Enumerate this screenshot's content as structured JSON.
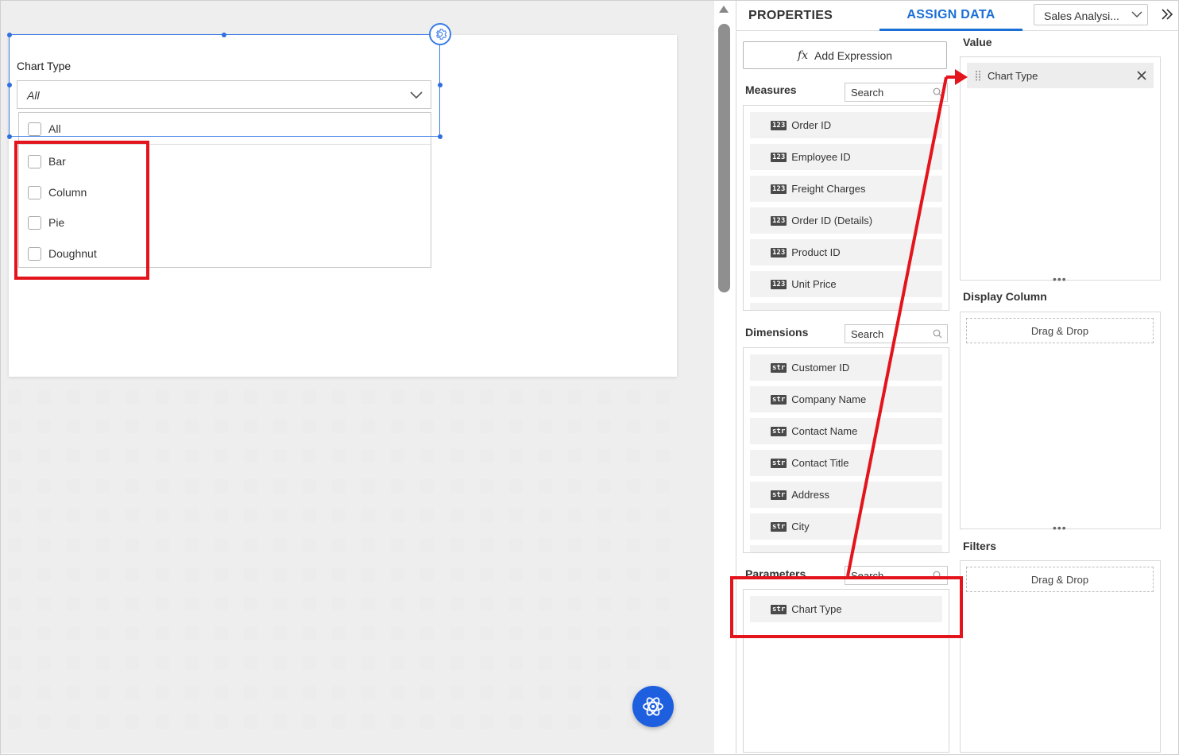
{
  "canvas": {
    "filter_widget": {
      "label": "Chart Type",
      "selected_value": "All",
      "options": [
        {
          "label": "All",
          "checked": false
        },
        {
          "label": "Bar",
          "checked": false
        },
        {
          "label": "Column",
          "checked": false
        },
        {
          "label": "Pie",
          "checked": false
        },
        {
          "label": "Doughnut",
          "checked": false
        }
      ]
    }
  },
  "panel": {
    "tabs": [
      {
        "label": "PROPERTIES",
        "active": false
      },
      {
        "label": "ASSIGN DATA",
        "active": true
      }
    ],
    "datasource": "Sales Analysi...",
    "add_expression": "Add Expression",
    "fx_glyph": "fx",
    "measures": {
      "title": "Measures",
      "search_placeholder": "Search",
      "items": [
        {
          "badge": "123",
          "name": "Order ID"
        },
        {
          "badge": "123",
          "name": "Employee ID"
        },
        {
          "badge": "123",
          "name": "Freight Charges"
        },
        {
          "badge": "123",
          "name": "Order ID (Details)"
        },
        {
          "badge": "123",
          "name": "Product ID"
        },
        {
          "badge": "123",
          "name": "Unit Price"
        }
      ]
    },
    "dimensions": {
      "title": "Dimensions",
      "search_placeholder": "Search",
      "items": [
        {
          "badge": "str",
          "name": "Customer ID"
        },
        {
          "badge": "str",
          "name": "Company Name"
        },
        {
          "badge": "str",
          "name": "Contact Name"
        },
        {
          "badge": "str",
          "name": "Contact Title"
        },
        {
          "badge": "str",
          "name": "Address"
        },
        {
          "badge": "str",
          "name": "City"
        }
      ]
    },
    "parameters": {
      "title": "Parameters",
      "search_placeholder": "Search",
      "items": [
        {
          "badge": "str",
          "name": "Chart Type"
        }
      ]
    },
    "zones": {
      "value": {
        "title": "Value",
        "assigned": "Chart Type"
      },
      "display_column": {
        "title": "Display Column",
        "placeholder": "Drag & Drop"
      },
      "filters": {
        "title": "Filters",
        "placeholder": "Drag & Drop"
      },
      "grip": "•••"
    }
  },
  "colors": {
    "accent": "#1a6fd6",
    "highlight": "#e3141b",
    "selection": "#3b7ce6",
    "fab": "#1e5fe0"
  }
}
